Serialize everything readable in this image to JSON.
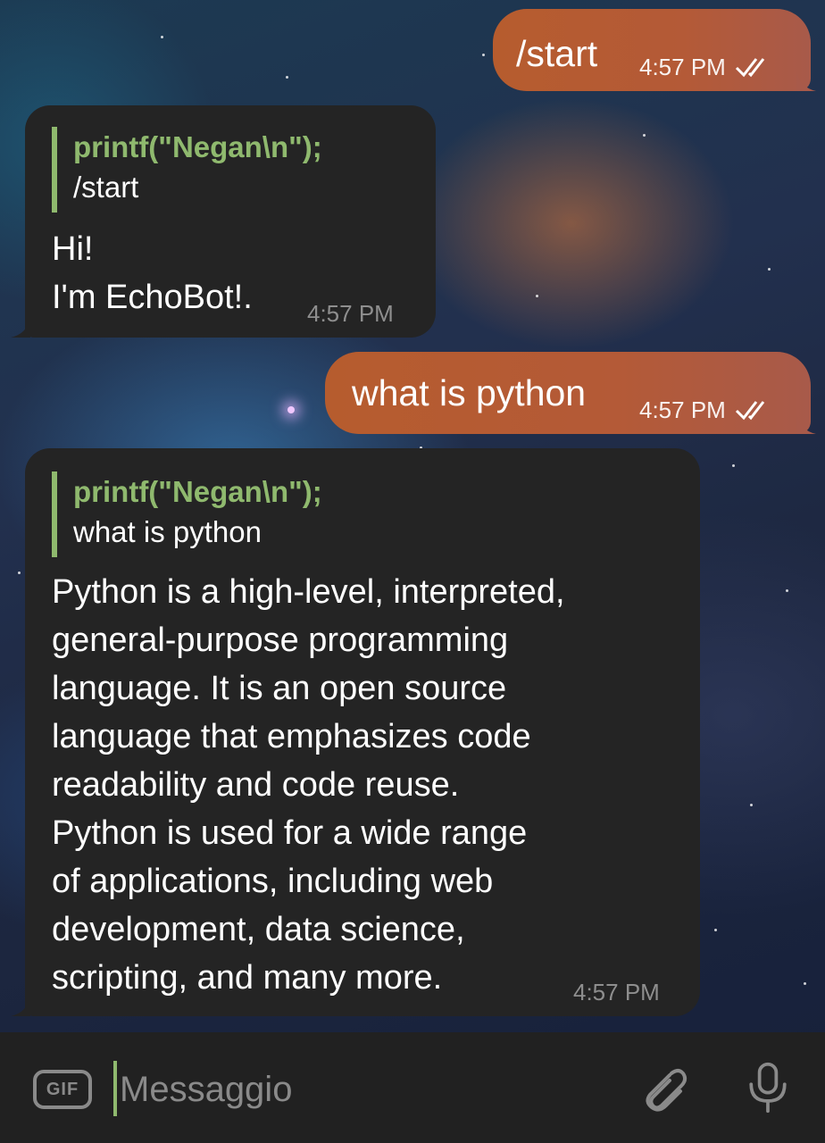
{
  "messages": [
    {
      "type": "outgoing",
      "text": "/start",
      "time": "4:57 PM"
    },
    {
      "type": "incoming",
      "reply": {
        "name": "printf(\"Negan\\n\");",
        "text": "/start"
      },
      "text": "Hi!\nI'm EchoBot!.",
      "time": "4:57 PM"
    },
    {
      "type": "outgoing",
      "text": "what is python",
      "time": "4:57 PM"
    },
    {
      "type": "incoming",
      "reply": {
        "name": "printf(\"Negan\\n\");",
        "text": "what is python"
      },
      "text": "Python is a high-level, interpreted,\ngeneral-purpose programming\nlanguage. It is an open source\nlanguage that emphasizes code\nreadability and code reuse.\nPython is used for a wide range\nof applications, including web\ndevelopment, data science,\nscripting, and many more.",
      "time": "4:57 PM"
    }
  ],
  "composer": {
    "placeholder": "Messaggio",
    "gif_label": "GIF"
  },
  "icons": {
    "gif": "gif-icon",
    "attach": "paperclip-icon",
    "mic": "microphone-icon",
    "read_status": "double-check-icon"
  },
  "colors": {
    "outgoing_bubble": "#b45a37",
    "incoming_bubble": "#242424",
    "reply_accent": "#8fb96e",
    "input_bar": "#212121"
  }
}
